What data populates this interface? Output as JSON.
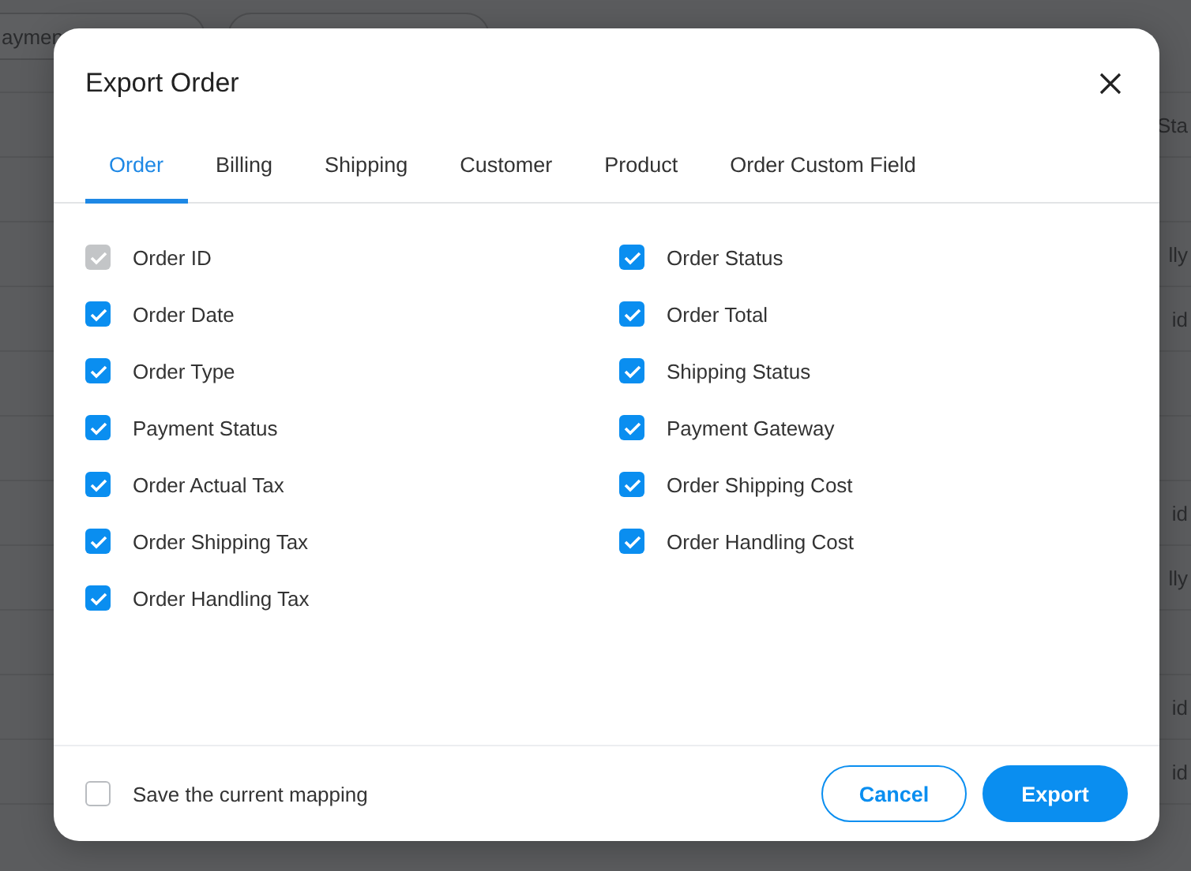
{
  "background": {
    "chip_label": "aymen",
    "column_header": "Sta",
    "rows": [
      {
        "text": null
      },
      {
        "text": "lly"
      },
      {
        "text": "id"
      },
      {
        "text": null
      },
      {
        "text": null
      },
      {
        "text": "id"
      },
      {
        "text": "lly"
      },
      {
        "text": null
      },
      {
        "text": "id"
      },
      {
        "text": "id"
      },
      {
        "text": null
      }
    ]
  },
  "dialog": {
    "title": "Export Order",
    "tabs": [
      {
        "label": "Order",
        "selected": true
      },
      {
        "label": "Billing",
        "selected": false
      },
      {
        "label": "Shipping",
        "selected": false
      },
      {
        "label": "Customer",
        "selected": false
      },
      {
        "label": "Product",
        "selected": false
      },
      {
        "label": "Order Custom Field",
        "selected": false
      }
    ],
    "fields": [
      {
        "label": "Order ID",
        "checked": true,
        "disabled": true
      },
      {
        "label": "Order Status",
        "checked": true,
        "disabled": false
      },
      {
        "label": "Order Date",
        "checked": true,
        "disabled": false
      },
      {
        "label": "Order Total",
        "checked": true,
        "disabled": false
      },
      {
        "label": "Order Type",
        "checked": true,
        "disabled": false
      },
      {
        "label": "Shipping Status",
        "checked": true,
        "disabled": false
      },
      {
        "label": "Payment Status",
        "checked": true,
        "disabled": false
      },
      {
        "label": "Payment Gateway",
        "checked": true,
        "disabled": false
      },
      {
        "label": "Order Actual Tax",
        "checked": true,
        "disabled": false
      },
      {
        "label": "Order Shipping Cost",
        "checked": true,
        "disabled": false
      },
      {
        "label": "Order Shipping Tax",
        "checked": true,
        "disabled": false
      },
      {
        "label": "Order Handling Cost",
        "checked": true,
        "disabled": false
      },
      {
        "label": "Order Handling Tax",
        "checked": true,
        "disabled": false
      }
    ],
    "save_mapping": {
      "label": "Save the current mapping",
      "checked": false
    },
    "buttons": [
      {
        "label": "Cancel",
        "kind": "secondary"
      },
      {
        "label": "Export",
        "kind": "primary"
      }
    ]
  }
}
